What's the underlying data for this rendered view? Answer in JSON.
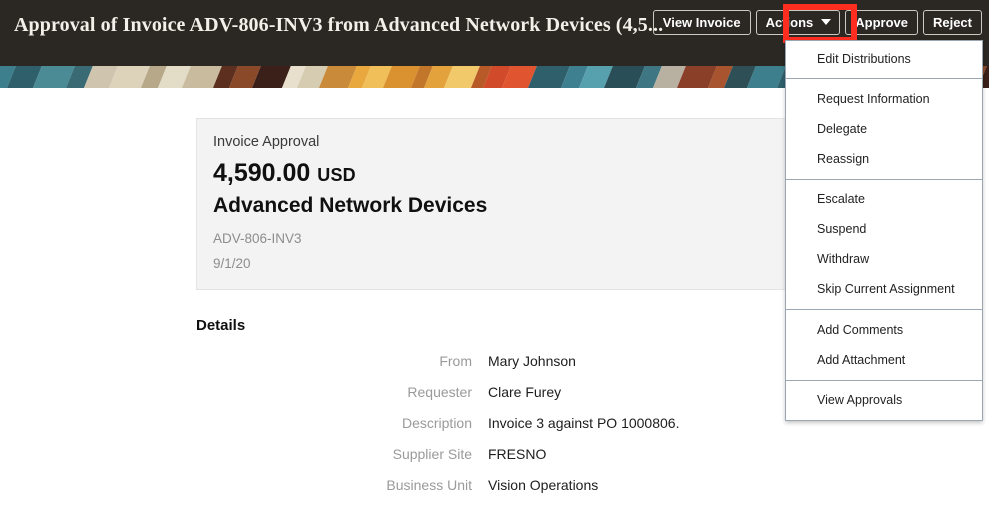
{
  "header": {
    "title": "Approval of Invoice ADV-806-INV3 from Advanced Network Devices (4,5...",
    "buttons": [
      {
        "label": "View Invoice",
        "name": "view-invoice-button"
      },
      {
        "label": "Actions",
        "name": "actions-button"
      },
      {
        "label": "Approve",
        "name": "approve-button"
      },
      {
        "label": "Reject",
        "name": "reject-button"
      }
    ],
    "highlight_color": "#fd2d20",
    "background_color": "#2b2722"
  },
  "banner": {
    "stripe_colors": [
      "#2f4f57",
      "#3d7f8c",
      "#2e5f6b",
      "#4a8b95",
      "#3a6b75",
      "#cfc4ad",
      "#ddd3bb",
      "#b8a88a",
      "#e3dcc6",
      "#c9bb9e",
      "#5d2f1f",
      "#8a4a2a",
      "#3a2018",
      "#e8e0cc",
      "#d6ccb2",
      "#c98a3a",
      "#e8a83e",
      "#f0bf5a",
      "#d9922f",
      "#c2762a",
      "#e3a23c",
      "#f2c96a",
      "#b85a28",
      "#d14a2a",
      "#e0552f",
      "#2f5f6b",
      "#3f8090",
      "#57a0ad",
      "#2a4e58",
      "#3f7684",
      "#b8b0a0",
      "#8a3f28",
      "#a8542f"
    ]
  },
  "card": {
    "kicker": "Invoice Approval",
    "amount": "4,590.00",
    "currency": "USD",
    "supplier": "Advanced Network Devices",
    "invoice_number": "ADV-806-INV3",
    "date": "9/1/20",
    "background_color": "#f3f3f3"
  },
  "details": {
    "heading": "Details",
    "rows": [
      {
        "label": "From",
        "value": "Mary Johnson"
      },
      {
        "label": "Requester",
        "value": "Clare Furey"
      },
      {
        "label": "Description",
        "value": "Invoice 3 against PO 1000806."
      },
      {
        "label": "Supplier Site",
        "value": "FRESNO"
      },
      {
        "label": "Business Unit",
        "value": "Vision Operations"
      }
    ]
  },
  "actions_menu": {
    "open": true,
    "groups": [
      {
        "items": [
          {
            "label": "Edit Distributions"
          }
        ]
      },
      {
        "items": [
          {
            "label": "Request Information"
          },
          {
            "label": "Delegate"
          },
          {
            "label": "Reassign"
          }
        ]
      },
      {
        "items": [
          {
            "label": "Escalate"
          },
          {
            "label": "Suspend"
          },
          {
            "label": "Withdraw"
          },
          {
            "label": "Skip Current Assignment"
          }
        ]
      },
      {
        "items": [
          {
            "label": "Add Comments"
          },
          {
            "label": "Add Attachment"
          }
        ]
      },
      {
        "items": [
          {
            "label": "View Approvals"
          }
        ]
      }
    ]
  }
}
